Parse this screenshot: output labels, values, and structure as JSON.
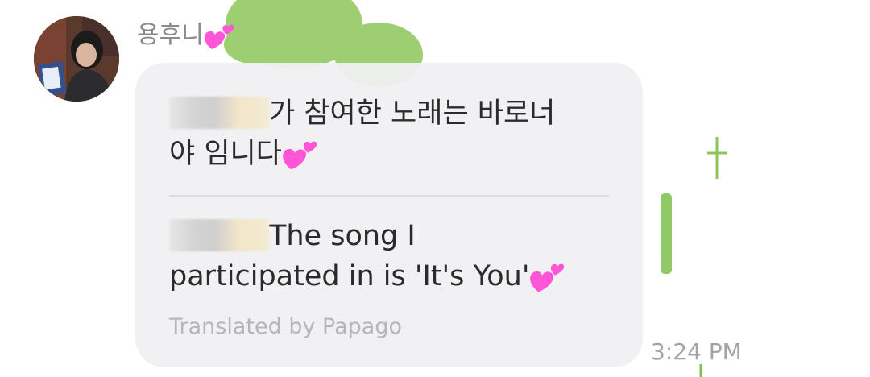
{
  "conversation": {
    "sender": {
      "name": "용후니",
      "avatar_icon": "profile-photo",
      "name_emoji_icon": "two-hearts-icon"
    },
    "message": {
      "original_lines": [
        "가 참여한 노래는 바로너",
        "야 임니다"
      ],
      "translated_lines": [
        "The song I",
        "participated in is 'It's You'"
      ],
      "translation_caption": "Translated by Papago",
      "emoji_icon": "two-hearts-icon",
      "redaction": "blurred-name"
    },
    "timestamp": "3:24 PM"
  },
  "colors": {
    "bubble": "#f0f0f2",
    "heart": "#ff4fd0",
    "background_doodle": "#7fbf4d",
    "muted_text": "#a3a3a3"
  }
}
